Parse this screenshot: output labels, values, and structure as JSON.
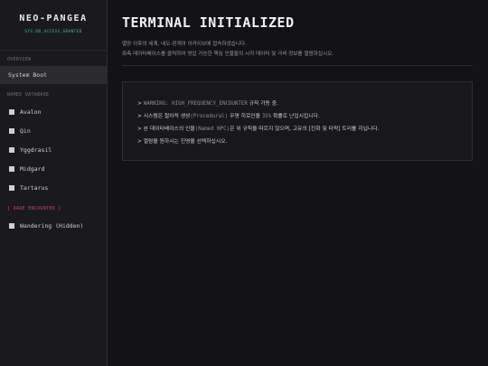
{
  "sidebar": {
    "title": "NEO-PANGEA",
    "subtitle": "SYS.DB_ACCESS_GRANTED",
    "overview_label": "OVERVIEW",
    "system_boot": "System Boot",
    "named_label": "NAMED DATABASE",
    "named_items": [
      "Avalon",
      "Qin",
      "Yggdrasil",
      "Midgard",
      "Tartarus"
    ],
    "rare_label": "[ RARE ENCOUNTER ]",
    "rare_item": "Wandering (Hidden)"
  },
  "main": {
    "title": "TERMINAL INITIALIZED",
    "desc1": "멸망 이후의 세계, 네오-판게아 아카이브에 접속하셨습니다.",
    "desc2": "좌측 데이터베이스를 클릭하여 영입 가능한 핵심 인물들의 시각 데이터 및 극비 정보를 열람하십시오.",
    "terminal": {
      "line1_prefix": "> ",
      "line1_mono": "WARNING: HIGH_FREQUENCY_ENCOUNTER",
      "line1_rest": " 규칙 가동 중.",
      "line2_a": "> 시스템은 절차적 생성",
      "line2_mono": "(Procedural)",
      "line2_b": " 무명 히로인을 ",
      "line2_mono2": "35%",
      "line2_c": " 확률로 난입시킵니다.",
      "line3_a": "> 본 데이터베이스의 인물",
      "line3_mono": "(Named NPC)",
      "line3_b": "은 위 규칙을 따르지 않으며, 고유의 [진화 및 타락] 트리를 지닙니다.",
      "line4": "> 열람을 원하시는 진영을 선택하십시오."
    }
  }
}
